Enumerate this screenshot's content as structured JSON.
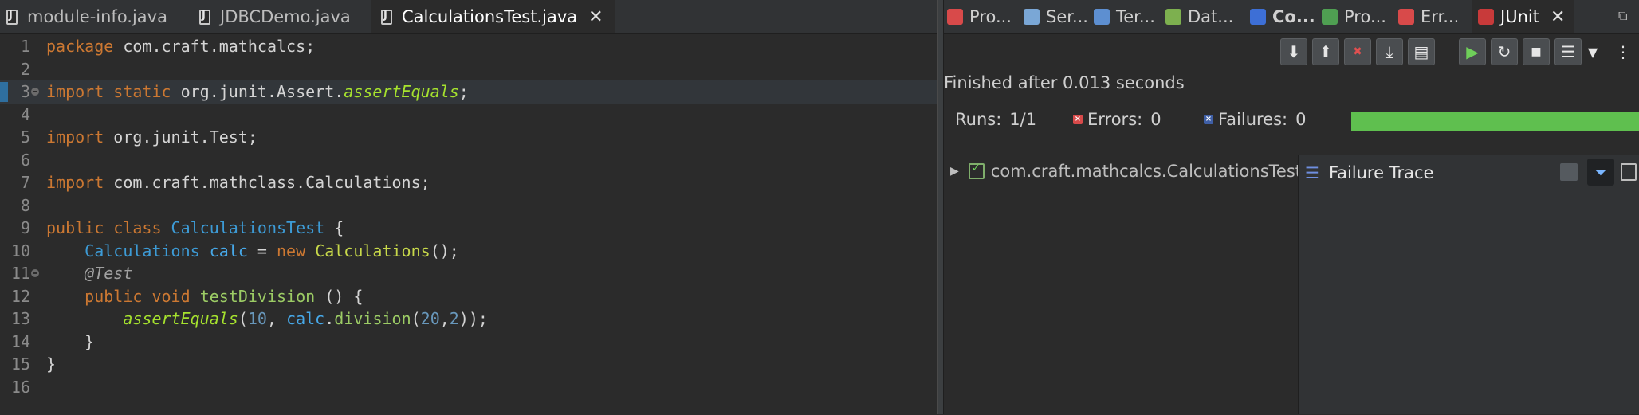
{
  "editor": {
    "tabs": [
      {
        "label": "module-info.java"
      },
      {
        "label": "JDBCDemo.java"
      },
      {
        "label": "CalculationsTest.java"
      }
    ],
    "close_icon": "close-icon",
    "lines": [
      {
        "n": "1",
        "tokens": [
          [
            "kw",
            "package "
          ],
          [
            "pl",
            "com.craft.mathcalcs;"
          ]
        ]
      },
      {
        "n": "2",
        "tokens": []
      },
      {
        "n": "3",
        "tokens": [
          [
            "kw",
            "import "
          ],
          [
            "kw",
            "static "
          ],
          [
            "pl",
            "org.junit.Assert."
          ],
          [
            "smeth",
            "assertEquals"
          ],
          [
            "pl",
            ";"
          ]
        ]
      },
      {
        "n": "4",
        "tokens": []
      },
      {
        "n": "5",
        "tokens": [
          [
            "kw",
            "import "
          ],
          [
            "pl",
            "org.junit.Test;"
          ]
        ]
      },
      {
        "n": "6",
        "tokens": []
      },
      {
        "n": "7",
        "tokens": [
          [
            "kw",
            "import "
          ],
          [
            "pl",
            "com.craft.mathclass.Calculations;"
          ]
        ]
      },
      {
        "n": "8",
        "tokens": []
      },
      {
        "n": "9",
        "tokens": [
          [
            "kw",
            "public "
          ],
          [
            "kw",
            "class "
          ],
          [
            "cls",
            "CalculationsTest"
          ],
          [
            "pl",
            " {"
          ]
        ]
      },
      {
        "n": "10",
        "tokens": [
          [
            "pl",
            "    "
          ],
          [
            "cls",
            "Calculations"
          ],
          [
            "pl",
            " "
          ],
          [
            "fld",
            "calc"
          ],
          [
            "pl",
            " = "
          ],
          [
            "kw",
            "new "
          ],
          [
            "ctor",
            "Calculations"
          ],
          [
            "pl",
            "();"
          ]
        ]
      },
      {
        "n": "11",
        "tokens": [
          [
            "pl",
            "    "
          ],
          [
            "ann",
            "@Test"
          ]
        ]
      },
      {
        "n": "12",
        "tokens": [
          [
            "pl",
            "    "
          ],
          [
            "kw",
            "public "
          ],
          [
            "kw",
            "void "
          ],
          [
            "meth",
            "testDivision"
          ],
          [
            "pl",
            " () {"
          ]
        ]
      },
      {
        "n": "13",
        "tokens": [
          [
            "pl",
            "        "
          ],
          [
            "smeth",
            "assertEquals"
          ],
          [
            "pl",
            "("
          ],
          [
            "num",
            "10"
          ],
          [
            "pl",
            ", "
          ],
          [
            "fld",
            "calc"
          ],
          [
            "pl",
            "."
          ],
          [
            "meth",
            "division"
          ],
          [
            "pl",
            "("
          ],
          [
            "num",
            "20"
          ],
          [
            "pl",
            ","
          ],
          [
            "num",
            "2"
          ],
          [
            "pl",
            "));"
          ]
        ]
      },
      {
        "n": "14",
        "tokens": [
          [
            "pl",
            "    }"
          ]
        ]
      },
      {
        "n": "15",
        "tokens": [
          [
            "pl",
            "}"
          ]
        ]
      },
      {
        "n": "16",
        "tokens": []
      }
    ]
  },
  "view": {
    "tabs": [
      {
        "label": "Pro...",
        "icon": "problems-icon",
        "color": "#d84a4a"
      },
      {
        "label": "Ser...",
        "icon": "servers-icon",
        "color": "#7aa7d6"
      },
      {
        "label": "Ter...",
        "icon": "terminal-icon",
        "color": "#5d8fd1"
      },
      {
        "label": "Dat...",
        "icon": "data-source-icon",
        "color": "#7db04f"
      },
      {
        "label": "Co...",
        "icon": "console-icon",
        "color": "#3d6fd6"
      },
      {
        "label": "Pro...",
        "icon": "progress-icon",
        "color": "#4f9f52"
      },
      {
        "label": "Err...",
        "icon": "error-log-icon",
        "color": "#d84a4a"
      },
      {
        "label": "JUnit",
        "icon": "junit-icon",
        "color": "#c83a3a"
      }
    ],
    "status": "Finished after 0.013 seconds",
    "runs": {
      "label": "Runs:",
      "value": "1/1"
    },
    "errors": {
      "label": "Errors:",
      "value": "0"
    },
    "failures": {
      "label": "Failures:",
      "value": "0"
    },
    "progress": {
      "fraction": 1.0,
      "color": "#5fbf4f"
    },
    "tree_item": "com.craft.mathcalcs.CalculationsTest [",
    "trace_title": "Failure Trace"
  }
}
